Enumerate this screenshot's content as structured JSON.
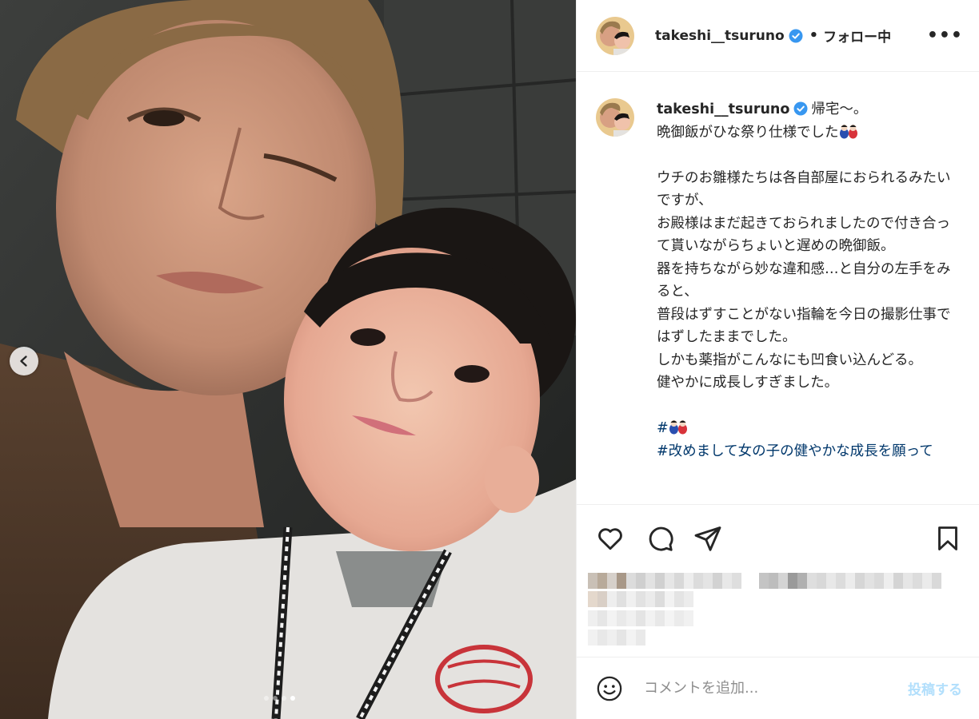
{
  "post": {
    "username": "takeshi__tsuruno",
    "follow_status": "フォロー中",
    "separator": "•",
    "more_label": "•••"
  },
  "caption": {
    "username": "takeshi__tsuruno",
    "line1": "帰宅〜。",
    "line2": "晩御飯がひな祭り仕様でした",
    "body": "ウチのお雛様たちは各自部屋におられるみたいですが、\nお殿様はまだ起きておられましたので付き合って貰いながらちょいと遅めの晩御飯。\n器を持ちながら妙な違和感…と自分の左手をみると、\n普段はずすことがない指輪を今日の撮影仕事ではずしたままでした。\nしかも薬指がこんなにも凹食い込んどる。\n健やかに成長しすぎました。",
    "hashtag1": "#",
    "hashtag2": "#改めまして女の子の健やかな成長を願って"
  },
  "actions": {
    "like_icon": "heart-icon",
    "comment_icon": "comment-icon",
    "share_icon": "paper-plane-icon",
    "save_icon": "bookmark-icon"
  },
  "comment_bar": {
    "placeholder": "コメントを追加...",
    "post_label": "投稿する",
    "emoji_icon": "smiley-icon"
  },
  "carousel": {
    "slide_count": 4,
    "active_slide": 4,
    "prev_icon": "chevron-left-icon"
  },
  "colors": {
    "verified_blue": "#3897f0",
    "link_blue": "#00376b",
    "post_button_disabled": "#b2dffc",
    "border": "#efefef"
  }
}
